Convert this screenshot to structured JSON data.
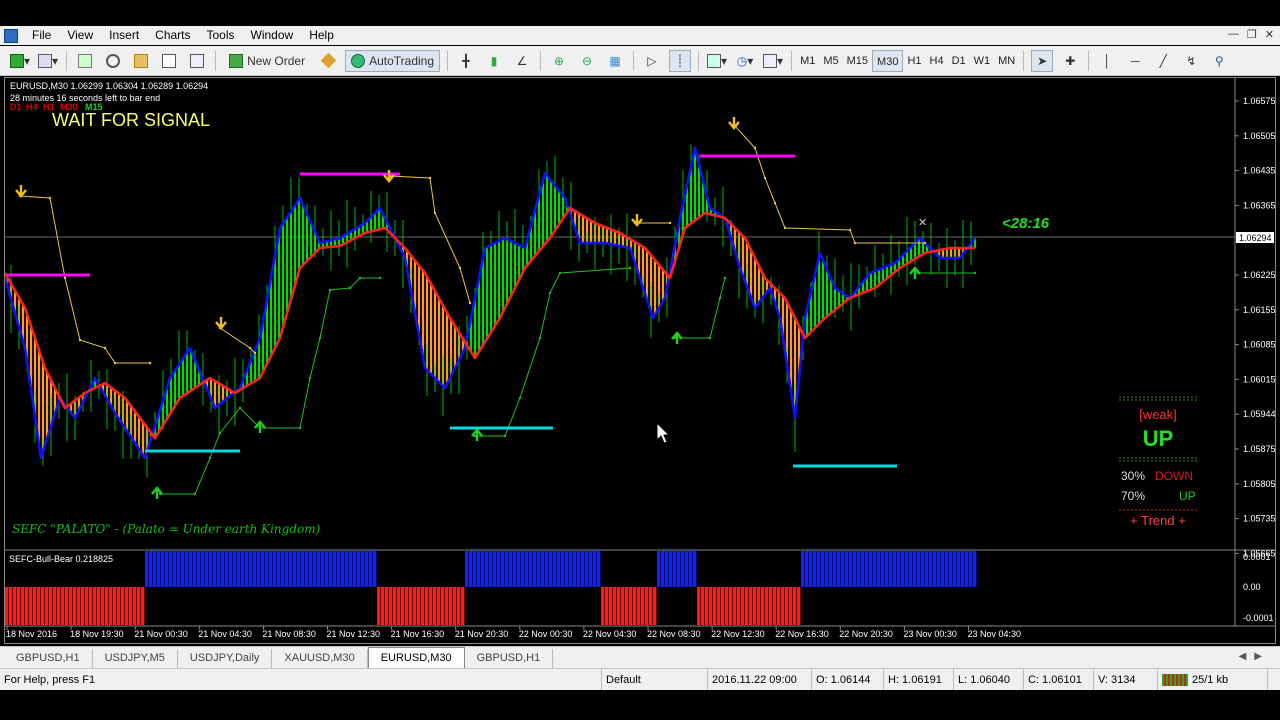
{
  "menu": [
    "File",
    "View",
    "Insert",
    "Charts",
    "Tools",
    "Window",
    "Help"
  ],
  "toolbar": {
    "new_order": "New Order",
    "autotrading": "AutoTrading",
    "timeframes": [
      "M1",
      "M5",
      "M15",
      "M30",
      "H1",
      "H4",
      "D1",
      "W1",
      "MN"
    ],
    "active_timeframe": "M30"
  },
  "chart": {
    "symbol_line": "EURUSD,M30  1.06299 1.06304 1.06289 1.06294",
    "countdown_line": "28 minutes 16 seconds left to bar end",
    "tf_labels": [
      "D1",
      "H4",
      "H1",
      "M30",
      "M15"
    ],
    "signal": "WAIT FOR SIGNAL",
    "timer": "<28:16",
    "watermark": "SEFC \"PALATO\" - (Palato = Under earth Kingdom)",
    "price_tag": "1.06294",
    "prices": [
      "1.06575",
      "1.06505",
      "1.06435",
      "1.06365",
      "1.06294",
      "1.06225",
      "1.06155",
      "1.06085",
      "1.06015",
      "1.05944",
      "1.05875",
      "1.05805",
      "1.05735",
      "1.05665"
    ],
    "panel": {
      "strength": "[weak]",
      "direction": "UP",
      "down_pct": "30%",
      "down_label": "DOWN",
      "up_pct": "70%",
      "up_label": "UP",
      "trend": "+  Trend  +"
    },
    "colors": {
      "bull": "#00e000",
      "bear": "#ff9c1a",
      "line_blue": "#1010ff",
      "line_red": "#ff2020",
      "magenta": "#ff00ff",
      "cyan": "#00dcdc",
      "signal_text": "#ffff66"
    }
  },
  "indicator": {
    "name": "SEFC-Bull-Bear 0.218825",
    "levels": [
      "0.0001",
      "0.00",
      "-0.0001"
    ]
  },
  "time_axis": [
    "18 Nov 2016",
    "18 Nov 19:30",
    "21 Nov 00:30",
    "21 Nov 04:30",
    "21 Nov 08:30",
    "21 Nov 12:30",
    "21 Nov 16:30",
    "21 Nov 20:30",
    "22 Nov 00:30",
    "22 Nov 04:30",
    "22 Nov 08:30",
    "22 Nov 12:30",
    "22 Nov 16:30",
    "22 Nov 20:30",
    "23 Nov 00:30",
    "23 Nov 04:30"
  ],
  "tabs": [
    "GBPUSD,H1",
    "USDJPY,M5",
    "USDJPY,Daily",
    "XAUUSD,M30",
    "EURUSD,M30",
    "GBPUSD,H1"
  ],
  "active_tab": 4,
  "status": {
    "help": "For Help, press F1",
    "profile": "Default",
    "datetime": "2016.11.22 09:00",
    "open": "O: 1.06144",
    "high": "H: 1.06191",
    "low": "L: 1.06040",
    "close": "C: 1.06101",
    "volume": "V: 3134",
    "traffic": "25/1 kb"
  }
}
